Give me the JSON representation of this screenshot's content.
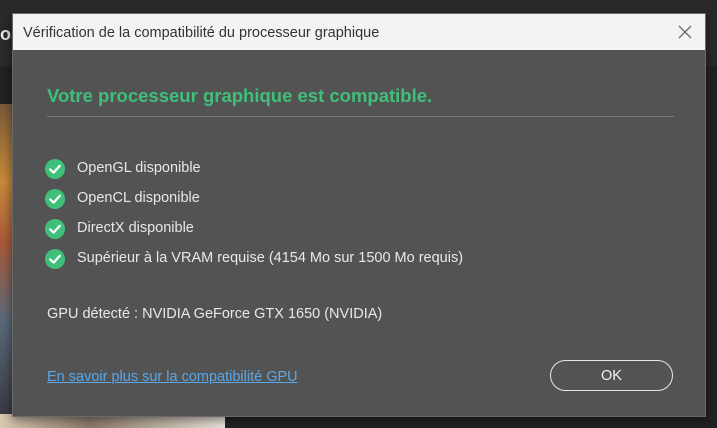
{
  "background": {
    "partial_title": "os"
  },
  "dialog": {
    "title": "Vérification de la compatibilité du processeur graphique",
    "headline": "Votre processeur graphique est compatible.",
    "checks": [
      {
        "label": "OpenGL disponible",
        "status": "ok"
      },
      {
        "label": "OpenCL disponible",
        "status": "ok"
      },
      {
        "label": "DirectX disponible",
        "status": "ok"
      },
      {
        "label": "Supérieur à la VRAM requise (4154 Mo sur 1500 Mo requis)",
        "status": "ok"
      }
    ],
    "gpu_detected": "GPU détecté : NVIDIA GeForce GTX 1650 (NVIDIA)",
    "learn_more_link": "En savoir plus sur la compatibilité GPU",
    "ok_button": "OK"
  },
  "colors": {
    "success": "#3fc07a",
    "link": "#5aa7ea",
    "dialog_bg": "#535353",
    "titlebar_bg": "#f3f3f3"
  },
  "icons": {
    "check": "check-circle-icon",
    "close": "close-icon"
  }
}
